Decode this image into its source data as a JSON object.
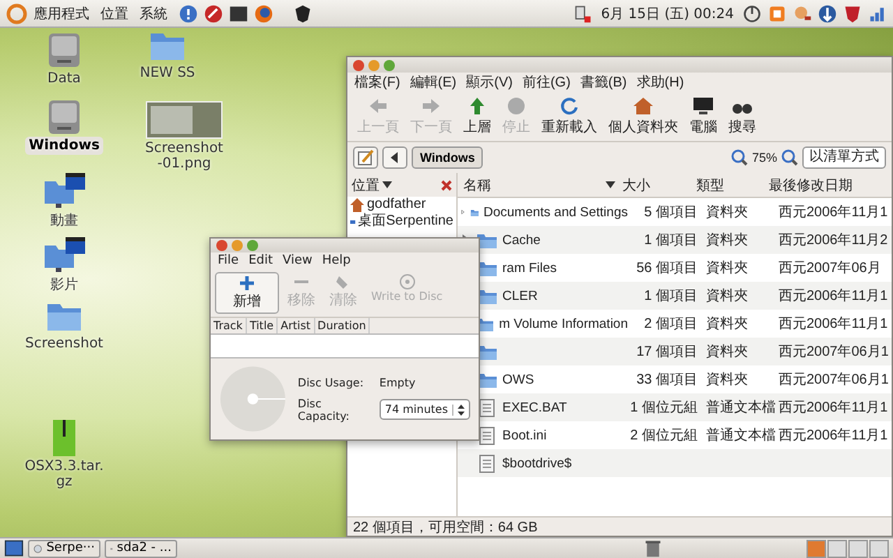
{
  "top_panel": {
    "menus": [
      "應用程式",
      "位置",
      "系統"
    ],
    "clock": "6月 15日 (五) 00:24"
  },
  "desktop_icons": [
    {
      "label": "Data",
      "kind": "drive",
      "selected": false
    },
    {
      "label": "NEW SS",
      "kind": "folder",
      "selected": false
    },
    {
      "label": "Windows",
      "kind": "drive",
      "selected": true
    },
    {
      "label": "Screenshot-01.png",
      "kind": "image",
      "selected": false
    },
    {
      "label": "動畫",
      "kind": "video-folder",
      "selected": false
    },
    {
      "label": "影片",
      "kind": "video-folder",
      "selected": false
    },
    {
      "label": "Screenshot",
      "kind": "folder",
      "selected": false
    },
    {
      "label": "OSX3.3.tar.gz",
      "kind": "archive",
      "selected": false
    }
  ],
  "file_manager": {
    "menu": [
      "檔案(F)",
      "編輯(E)",
      "顯示(V)",
      "前往(G)",
      "書籤(B)",
      "求助(H)"
    ],
    "toolbar": [
      {
        "label": "上一頁",
        "kind": "back",
        "disabled": true
      },
      {
        "label": "下一頁",
        "kind": "forward",
        "disabled": true
      },
      {
        "label": "上層",
        "kind": "up",
        "disabled": false
      },
      {
        "label": "停止",
        "kind": "stop",
        "disabled": true
      },
      {
        "label": "重新載入",
        "kind": "reload",
        "disabled": false
      },
      {
        "label": "個人資料夾",
        "kind": "home",
        "disabled": false
      },
      {
        "label": "電腦",
        "kind": "computer",
        "disabled": false
      },
      {
        "label": "搜尋",
        "kind": "search",
        "disabled": false
      }
    ],
    "path_button": "Windows",
    "zoom": "75%",
    "view_mode": "以清單方式",
    "sidebar": {
      "title": "位置",
      "items": [
        {
          "label": "godfather",
          "kind": "home"
        },
        {
          "label": "桌面Serpentine",
          "kind": "desktop"
        }
      ]
    },
    "columns": [
      "名稱",
      "大小",
      "類型",
      "最後修改日期"
    ],
    "rows": [
      {
        "kind": "folder",
        "name": "Documents and Settings",
        "size": "5 個項目",
        "type": "資料夾",
        "modified": "西元2006年11月1"
      },
      {
        "kind": "folder",
        "name": "Cache",
        "size": "1 個項目",
        "type": "資料夾",
        "modified": "西元2006年11月2"
      },
      {
        "kind": "folder",
        "name": "ram Files",
        "size": "56 個項目",
        "type": "資料夾",
        "modified": "西元2007年06月"
      },
      {
        "kind": "folder",
        "name": "CLER",
        "size": "1 個項目",
        "type": "資料夾",
        "modified": "西元2006年11月1"
      },
      {
        "kind": "folder",
        "name": "m Volume Information",
        "size": "2 個項目",
        "type": "資料夾",
        "modified": "西元2006年11月1"
      },
      {
        "kind": "folder",
        "size": "17 個項目",
        "type": "資料夾",
        "modified": "西元2007年06月1"
      },
      {
        "kind": "folder",
        "name": "OWS",
        "size": "33 個項目",
        "type": "資料夾",
        "modified": "西元2007年06月1"
      },
      {
        "kind": "file",
        "name": "EXEC.BAT",
        "size": "1 個位元組",
        "type": "普通文本檔",
        "modified": "西元2006年11月1"
      },
      {
        "kind": "file",
        "name": "Boot.ini",
        "size": "2 個位元組",
        "type": "普通文本檔",
        "modified": "西元2006年11月1"
      },
      {
        "kind": "file",
        "name": "$bootdrive$"
      }
    ],
    "status": "22 個項目，可用空間：64 GB"
  },
  "disc_burner": {
    "menu": [
      "File",
      "Edit",
      "View",
      "Help"
    ],
    "toolbar": [
      {
        "label": "新增",
        "kind": "add",
        "disabled": false
      },
      {
        "label": "移除",
        "kind": "remove",
        "disabled": true
      },
      {
        "label": "清除",
        "kind": "clear",
        "disabled": true
      },
      {
        "label": "Write to Disc",
        "kind": "burn",
        "disabled": true
      }
    ],
    "columns": [
      "Track",
      "Title",
      "Artist",
      "Duration"
    ],
    "usage_label": "Disc Usage:",
    "usage": "Empty",
    "capacity_label": "Disc Capacity:",
    "capacity": "74 minutes"
  },
  "taskbar": {
    "tasks": [
      {
        "label": "Serpe···",
        "kind": "burner"
      },
      {
        "label": "sda2 - ...",
        "kind": "drive"
      }
    ],
    "workspaces": [
      {
        "selected": true
      },
      {
        "selected": false
      },
      {
        "selected": false
      },
      {
        "selected": false
      }
    ]
  }
}
